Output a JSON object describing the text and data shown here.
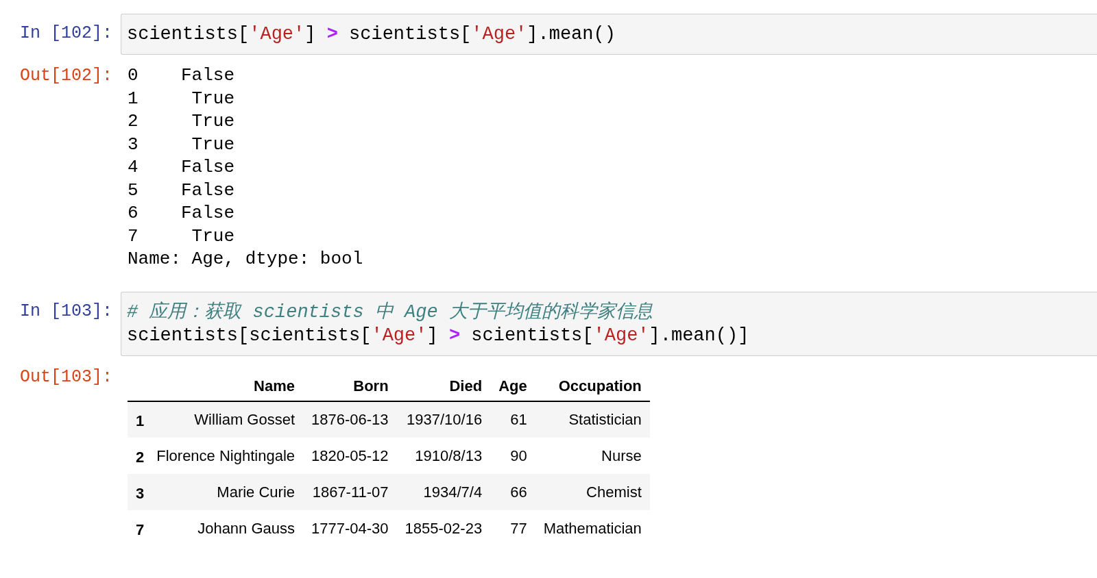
{
  "cells": [
    {
      "kind": "input",
      "prompt": "In [102]:",
      "lines": [
        [
          {
            "kind": "plain",
            "text": "scientists["
          },
          {
            "kind": "string",
            "text": "'Age'"
          },
          {
            "kind": "plain",
            "text": "] "
          },
          {
            "kind": "operator",
            "text": ">"
          },
          {
            "kind": "plain",
            "text": " scientists["
          },
          {
            "kind": "string",
            "text": "'Age'"
          },
          {
            "kind": "plain",
            "text": "].mean()"
          }
        ]
      ]
    },
    {
      "kind": "text_output",
      "prompt": "Out[102]:",
      "lines": [
        "0    False",
        "1     True",
        "2     True",
        "3     True",
        "4    False",
        "5    False",
        "6    False",
        "7     True",
        "Name: Age, dtype: bool"
      ]
    },
    {
      "kind": "input",
      "prompt": "In [103]:",
      "lines": [
        [
          {
            "kind": "comment",
            "text": "# 应用：获取 scientists 中 Age 大于平均值的科学家信息"
          }
        ],
        [
          {
            "kind": "plain",
            "text": "scientists[scientists["
          },
          {
            "kind": "string",
            "text": "'Age'"
          },
          {
            "kind": "plain",
            "text": "] "
          },
          {
            "kind": "operator",
            "text": ">"
          },
          {
            "kind": "plain",
            "text": " scientists["
          },
          {
            "kind": "string",
            "text": "'Age'"
          },
          {
            "kind": "plain",
            "text": "].mean()]"
          }
        ]
      ]
    },
    {
      "kind": "table_output",
      "prompt": "Out[103]:",
      "columns": [
        "Name",
        "Born",
        "Died",
        "Age",
        "Occupation"
      ],
      "rows": [
        {
          "index": "1",
          "cells": [
            "William Gosset",
            "1876-06-13",
            "1937/10/16",
            "61",
            "Statistician"
          ]
        },
        {
          "index": "2",
          "cells": [
            "Florence Nightingale",
            "1820-05-12",
            "1910/8/13",
            "90",
            "Nurse"
          ]
        },
        {
          "index": "3",
          "cells": [
            "Marie Curie",
            "1867-11-07",
            "1934/7/4",
            "66",
            "Chemist"
          ]
        },
        {
          "index": "7",
          "cells": [
            "Johann Gauss",
            "1777-04-30",
            "1855-02-23",
            "77",
            "Mathematician"
          ]
        }
      ]
    }
  ]
}
